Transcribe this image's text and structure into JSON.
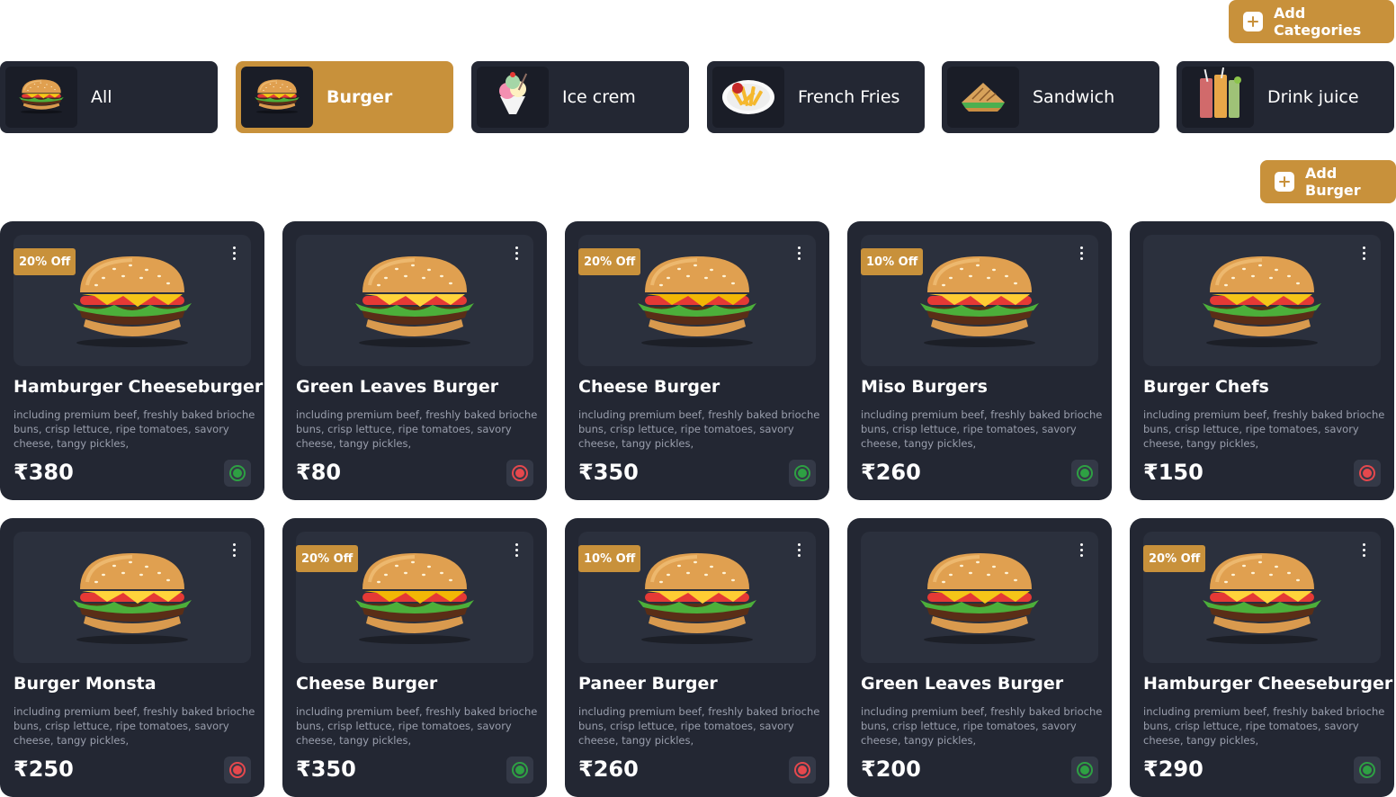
{
  "actions": {
    "add_categories_label": "Add Categories",
    "add_item_label": "Add Burger"
  },
  "categories": [
    {
      "label": "All",
      "icon": "burger-icon",
      "active": false
    },
    {
      "label": "Burger",
      "icon": "burger-icon",
      "active": true
    },
    {
      "label": "Ice crem",
      "icon": "ice-cream-icon",
      "active": false
    },
    {
      "label": "French Fries",
      "icon": "french-fries-icon",
      "active": false
    },
    {
      "label": "Sandwich",
      "icon": "sandwich-icon",
      "active": false
    },
    {
      "label": "Drink juice",
      "icon": "juice-icon",
      "active": false
    }
  ],
  "items": [
    {
      "name": "Hamburger Cheeseburger",
      "discount": "20% Off",
      "description": "including premium beef, freshly baked brioche buns, crisp lettuce, ripe tomatoes, savory cheese, tangy pickles,",
      "price": "₹380",
      "status": "green"
    },
    {
      "name": "Green Leaves Burger",
      "discount": "",
      "description": "including premium beef, freshly baked brioche buns, crisp lettuce, ripe tomatoes, savory cheese, tangy pickles,",
      "price": "₹80",
      "status": "red"
    },
    {
      "name": " Cheese Burger",
      "discount": "20% Off",
      "description": "including premium beef, freshly baked brioche buns, crisp lettuce, ripe tomatoes, savory cheese, tangy pickles,",
      "price": "₹350",
      "status": "green"
    },
    {
      "name": "Miso Burgers",
      "discount": "10% Off",
      "description": "including premium beef, freshly baked brioche buns, crisp lettuce, ripe tomatoes, savory cheese, tangy pickles,",
      "price": "₹260",
      "status": "green"
    },
    {
      "name": "Burger Chefs",
      "discount": "",
      "description": "including premium beef, freshly baked brioche buns, crisp lettuce, ripe tomatoes, savory cheese, tangy pickles,",
      "price": "₹150",
      "status": "red"
    },
    {
      "name": "Burger Monsta",
      "discount": "",
      "description": "including premium beef, freshly baked brioche buns, crisp lettuce, ripe tomatoes, savory cheese, tangy pickles,",
      "price": "₹250",
      "status": "red"
    },
    {
      "name": " Cheese Burger",
      "discount": "20% Off",
      "description": "including premium beef, freshly baked brioche buns, crisp lettuce, ripe tomatoes, savory cheese, tangy pickles,",
      "price": "₹350",
      "status": "green"
    },
    {
      "name": "Paneer Burger",
      "discount": "10% Off",
      "description": "including premium beef, freshly baked brioche buns, crisp lettuce, ripe tomatoes, savory cheese, tangy pickles,",
      "price": "₹260",
      "status": "red"
    },
    {
      "name": "Green Leaves Burger",
      "discount": "",
      "description": "including premium beef, freshly baked brioche buns, crisp lettuce, ripe tomatoes, savory cheese, tangy pickles,",
      "price": "₹200",
      "status": "green"
    },
    {
      "name": "Hamburger Cheeseburger",
      "discount": "20% Off",
      "description": "including premium beef, freshly baked brioche buns, crisp lettuce, ripe tomatoes, savory cheese, tangy pickles,",
      "price": "₹290",
      "status": "green"
    }
  ],
  "colors": {
    "accent": "#C8913B",
    "card_bg": "#232733",
    "status_available": "#2EA043",
    "status_unavailable": "#E5484D"
  }
}
